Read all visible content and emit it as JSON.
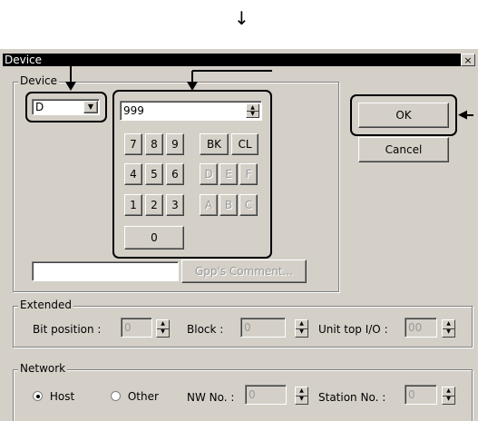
{
  "window": {
    "title": "Device",
    "close_label": "×"
  },
  "device_group": {
    "label": "Device",
    "device_type": "D",
    "device_number": "999",
    "digits": [
      "7",
      "8",
      "9",
      "4",
      "5",
      "6",
      "1",
      "2",
      "3"
    ],
    "zero": "0",
    "bk_label": "BK",
    "cl_label": "CL",
    "hex_keys": [
      "D",
      "E",
      "F",
      "A",
      "B",
      "C"
    ],
    "comment_value": "",
    "comment_button": "Gpp's Comment..."
  },
  "buttons": {
    "ok": "OK",
    "cancel": "Cancel"
  },
  "extended": {
    "label": "Extended",
    "bit_position_label": "Bit position :",
    "bit_position_value": "0",
    "block_label": "Block :",
    "block_value": "0",
    "unit_top_label": "Unit top I/O :",
    "unit_top_value": "00"
  },
  "network": {
    "label": "Network",
    "host_label": "Host",
    "other_label": "Other",
    "selected": "Host",
    "nw_no_label": "NW No. :",
    "nw_no_value": "0",
    "station_label": "Station No. :",
    "station_value": "0"
  },
  "annotation": {
    "top_arrow": "↓",
    "ok_arrow": "◀"
  }
}
